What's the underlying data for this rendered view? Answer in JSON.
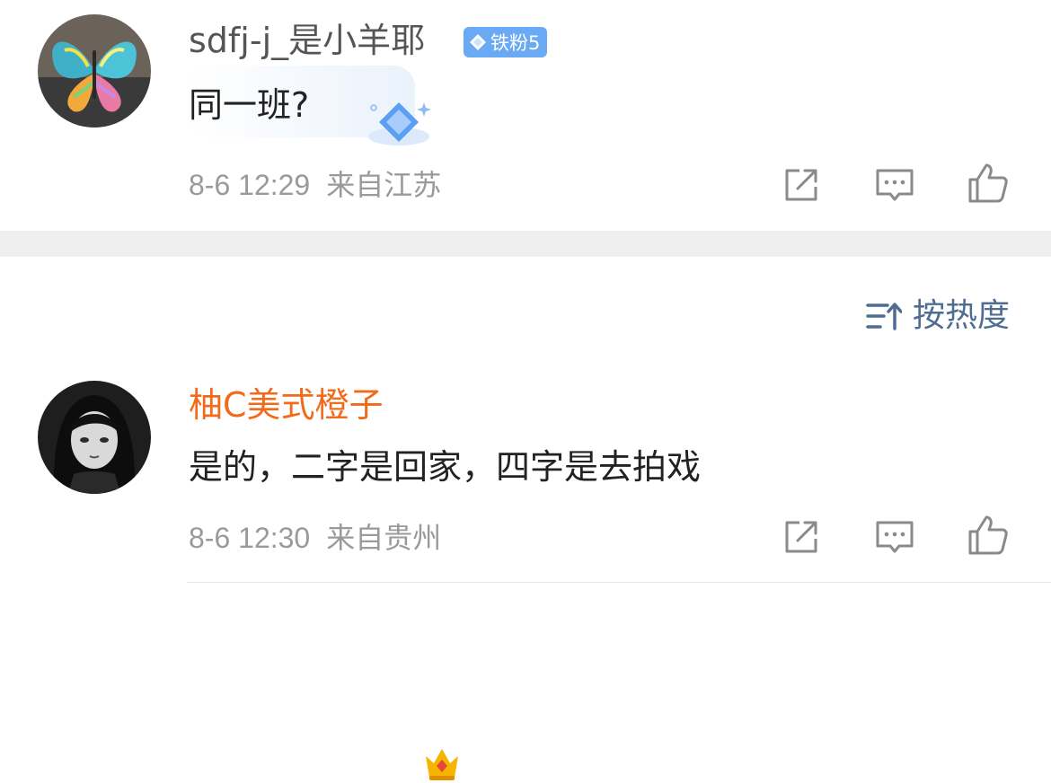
{
  "comments": [
    {
      "username": "sdfj-j_是小羊耶",
      "username_color": "#555555",
      "badge": "铁粉5",
      "text": "同一班?",
      "date": "8-6 12:29",
      "location": "来自江苏"
    },
    {
      "username": "柚C美式橙子",
      "username_color": "#f26a1b",
      "text": "是的，二字是回家，四字是去拍戏",
      "date": "8-6 12:30",
      "location": "来自贵州"
    }
  ],
  "sort": {
    "label": "按热度"
  },
  "colors": {
    "accent": "#4f6d92",
    "badge_bg": "#6aa9f4",
    "meta": "#9a9a9a",
    "divider": "#efefef"
  },
  "icons": {
    "share": "share-icon",
    "comment": "comment-icon",
    "like": "thumbs-up-icon",
    "sort": "sort-icon",
    "crown": "crown-icon",
    "gem": "diamond-icon"
  }
}
